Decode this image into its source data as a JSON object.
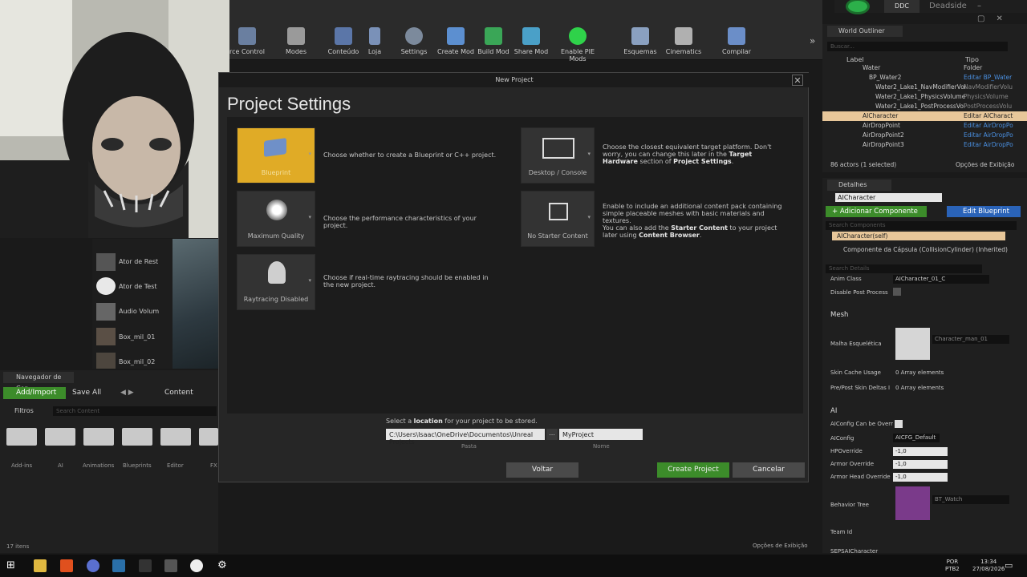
{
  "toolbar": {
    "items": [
      {
        "label": "rce Control"
      },
      {
        "label": "Modes"
      },
      {
        "label": "Conteúdo"
      },
      {
        "label": "Loja"
      },
      {
        "label": "Settings"
      },
      {
        "label": "Create Mod"
      },
      {
        "label": "Build Mod"
      },
      {
        "label": "Share Mod"
      },
      {
        "label": "Enable PIE Mods"
      },
      {
        "label": "Esquemas"
      },
      {
        "label": "Cinematics"
      },
      {
        "label": "Compilar"
      }
    ],
    "overflow": "»"
  },
  "titlebar": {
    "ddc": "DDC",
    "project": "Deadside"
  },
  "outliner": {
    "tab": "World Outliner",
    "search_placeholder": "Buscar...",
    "col_label": "Label",
    "col_type": "Tipo",
    "rows": [
      {
        "label": "Water",
        "type": "Folder"
      },
      {
        "label": "BP_Water2",
        "type": "Editar BP_Water"
      },
      {
        "label": "Water2_Lake1_NavModifierVol",
        "type": "NavModifierVolu"
      },
      {
        "label": "Water2_Lake1_PhysicsVolume",
        "type": "PhysicsVolume"
      },
      {
        "label": "Water2_Lake1_PostProcessVol",
        "type": "PostProcessVolu"
      },
      {
        "label": "AICharacter",
        "type": "Editar AICharact"
      },
      {
        "label": "AirDropPoint",
        "type": "Editar AirDropPo"
      },
      {
        "label": "AirDropPoint2",
        "type": "Editar AirDropPo"
      },
      {
        "label": "AirDropPoint3",
        "type": "Editar AirDropPo"
      }
    ],
    "status": "86 actors (1 selected)",
    "view_options": "Opções de Exibição"
  },
  "details": {
    "tab": "Detalhes",
    "name": "AICharacter",
    "add_component": "+ Adicionar Componente",
    "edit_blueprint": "Edit Blueprint",
    "search_components": "Search Components",
    "self": "AICharacter(self)",
    "component": "Componente da Cápsula (CollisionCylinder) (Inherited)",
    "search_details": "Search Details",
    "anim_class_label": "Anim Class",
    "anim_class_value": "AICharacter_01_C",
    "disable_post": "Disable Post Process",
    "mesh_section": "Mesh",
    "skeletal_mesh_label": "Malha Esquelética",
    "skeletal_mesh_value": "Character_man_01",
    "skin_cache_label": "Skin Cache Usage",
    "skin_cache_value": "0 Array elements",
    "pre_post_label": "Pre/Post Skin Deltas I",
    "pre_post_value": "0 Array elements",
    "ai_section": "AI",
    "aiconfig_override": "AIConfig Can be Overr",
    "aiconfig_label": "AIConfig",
    "aiconfig_value": "AICFG_Default",
    "hp_label": "HPOverride",
    "hp_value": "-1,0",
    "armor_label": "Armor Override",
    "armor_value": "-1,0",
    "armor_head_label": "Armor Head Override",
    "armor_head_value": "-1,0",
    "behavior_label": "Behavior Tree",
    "behavior_value": "BT_Watch",
    "team_label": "Team Id",
    "footer": "SEPSAICharacter"
  },
  "content_browser": {
    "tab": "Navegador de Con",
    "add_import": "Add/Import",
    "save_all": "Save All",
    "path": "Content",
    "filters": "Filtros",
    "search_placeholder": "Search Content",
    "folders": [
      "Add-ins",
      "AI",
      "Animations",
      "Blueprints",
      "Editor",
      "FX"
    ],
    "items_count": "17 itens",
    "view_options": "Opções de Exibição"
  },
  "place_actors": [
    {
      "label": "Ator de Rest"
    },
    {
      "label": "Ator de Test"
    },
    {
      "label": "Audio Volum"
    },
    {
      "label": "Box_mil_01"
    },
    {
      "label": "Box_mil_02"
    }
  ],
  "dialog": {
    "title": "New Project",
    "heading": "Project Settings",
    "cards": [
      {
        "label": "Blueprint",
        "desc": "Choose whether to create a Blueprint or C++ project."
      },
      {
        "label": "Maximum Quality",
        "desc": "Choose the performance characteristics of your project."
      },
      {
        "label": "Raytracing Disabled",
        "desc": "Choose if real-time raytracing should be enabled in the new project."
      },
      {
        "label": "Desktop / Console",
        "desc1": "Choose the closest equivalent target platform. Don't worry, you can change this later in the ",
        "desc_b": "Target Hardware",
        "desc2": " section of ",
        "desc_b2": "Project Settings",
        "desc3": "."
      },
      {
        "label": "No Starter Content",
        "desc1": "Enable to include an additional content pack containing simple placeable meshes with basic materials and textures.",
        "desc2": "You can also add the ",
        "desc_b": "Starter Content",
        "desc3": " to your project later using ",
        "desc_b2": "Content Browser",
        "desc4": "."
      }
    ],
    "location_prompt_1": "Select a ",
    "location_prompt_b": "location",
    "location_prompt_2": " for your project to be stored.",
    "folder_value": "C:\\Users\\Isaac\\OneDrive\\Documentos\\Unreal Projects",
    "browse": "...",
    "name_value": "MyProject",
    "folder_caption": "Pasta",
    "name_caption": "Nome",
    "back": "Voltar",
    "create": "Create Project",
    "cancel": "Cancelar"
  },
  "taskbar": {
    "lang": "POR",
    "layout": "PTB2",
    "time": "13:34",
    "date": "27/08/2026"
  }
}
